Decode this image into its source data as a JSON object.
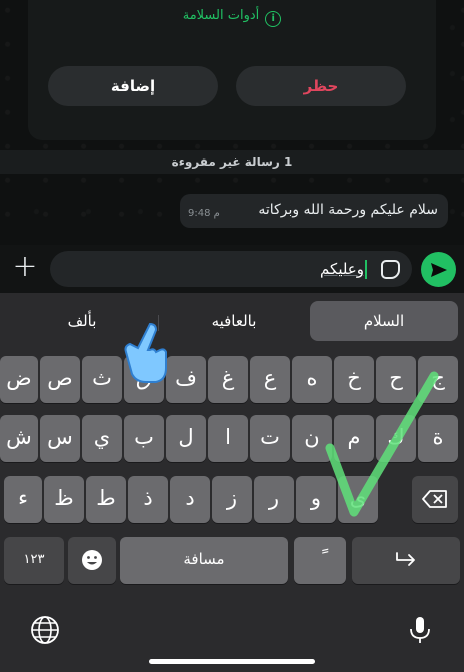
{
  "block_card": {
    "safety_tools": "أدوات السلامة",
    "block_label": "حظر",
    "add_label": "إضافة"
  },
  "unread_banner": "1 رسالة غير مقروءة",
  "message": {
    "text": "سلام عليكم ورحمة الله وبركاته",
    "time": "9:48 م"
  },
  "composer": {
    "text": "وعليكم"
  },
  "keyboard": {
    "suggestions": [
      "السلام",
      "بالعافيه",
      "بألف"
    ],
    "row1": [
      "ج",
      "ح",
      "خ",
      "ه",
      "ع",
      "غ",
      "ف",
      "ق",
      "ث",
      "ص",
      "ض"
    ],
    "row2": [
      "ة",
      "ك",
      "م",
      "ن",
      "ت",
      "ا",
      "ل",
      "ب",
      "ي",
      "س",
      "ش"
    ],
    "row3": [
      "ى",
      "و",
      "ر",
      "ز",
      "د",
      "ذ",
      "ط",
      "ظ",
      "ء"
    ],
    "numbers_label": "١٢٣",
    "space_label": "مسافة",
    "tanween_label": "ً"
  },
  "colors": {
    "accent_green": "#21c063",
    "block_red": "#e0465e"
  }
}
